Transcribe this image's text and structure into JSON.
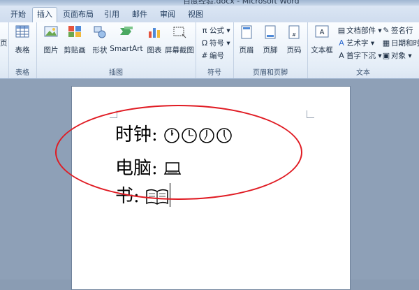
{
  "window": {
    "title": "百度经验.docx - Microsoft Word"
  },
  "tabs": [
    {
      "label": "开始"
    },
    {
      "label": "插入"
    },
    {
      "label": "页面布局"
    },
    {
      "label": "引用"
    },
    {
      "label": "邮件"
    },
    {
      "label": "审阅"
    },
    {
      "label": "视图"
    }
  ],
  "ribbon": {
    "tables": {
      "group_label": "表格",
      "table_label": "表格"
    },
    "illustrations": {
      "group_label": "插图",
      "picture": "图片",
      "clipart": "剪贴画",
      "shapes": "形状",
      "smartart": "SmartArt",
      "chart": "图表",
      "screenshot": "屏幕截图"
    },
    "symbols": {
      "group_label": "符号",
      "equation": "公式",
      "symbol": "符号",
      "number": "编号"
    },
    "header_footer": {
      "group_label": "页眉和页脚",
      "header": "页眉",
      "footer": "页脚",
      "page_number": "页码"
    },
    "text": {
      "group_label": "文本",
      "textbox": "文本框",
      "quickparts": "文档部件",
      "wordart": "艺术字",
      "dropcap": "首字下沉",
      "signature": "签名行",
      "datetime": "日期和时",
      "object": "对象"
    },
    "left_partial": "页"
  },
  "document": {
    "line1": "时钟:",
    "line2": "电脑:",
    "line3": "书:"
  },
  "colors": {
    "annotation": "#e01a22"
  }
}
